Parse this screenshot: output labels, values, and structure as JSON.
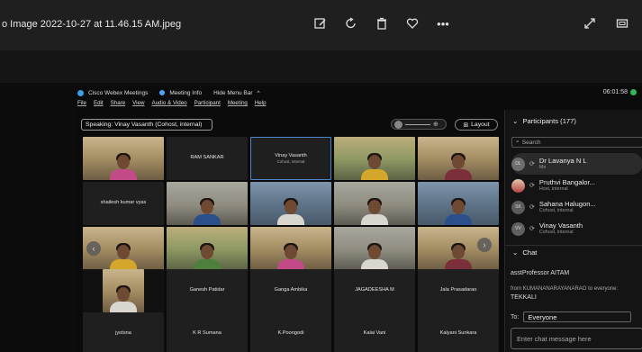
{
  "viewer": {
    "title": "o Image 2022-10-27 at 11.46.15 AM.jpeg",
    "tools": [
      "edit-icon",
      "rotate-icon",
      "trash-icon",
      "heart-icon",
      "more-icon"
    ],
    "right_tools": [
      "expand-icon",
      "fit-screen-icon"
    ],
    "more_label": "•••"
  },
  "webex": {
    "app_name": "Cisco Webex Meetings",
    "meeting_info": "Meeting Info",
    "hide_menu": "Hide Menu Bar",
    "time": "06:01:58",
    "menu": [
      "File",
      "Edit",
      "Share",
      "View",
      "Audio & Video",
      "Participant",
      "Meeting",
      "Help"
    ],
    "speaking": "Speaking: Vinay Vasanth (Cohost, internal)",
    "layout_label": "Layout",
    "tiles": [
      {
        "name": "",
        "video": true
      },
      {
        "name": "RAM SANKAR",
        "video": false
      },
      {
        "name": "Vinay Vasanth",
        "sub": "Cohost, internal",
        "video": false,
        "active": true
      },
      {
        "name": "",
        "video": true
      },
      {
        "name": "",
        "video": true
      },
      {
        "name": "shailesh kumar vyas",
        "video": false
      },
      {
        "name": "",
        "video": true
      },
      {
        "name": "",
        "video": true
      },
      {
        "name": "",
        "video": true
      },
      {
        "name": "",
        "video": true
      },
      {
        "name": "",
        "video": true
      },
      {
        "name": "",
        "video": true
      },
      {
        "name": "",
        "video": true
      },
      {
        "name": "",
        "video": true
      },
      {
        "name": "",
        "video": true
      },
      {
        "name": "",
        "video": true
      },
      {
        "name": "Ganesh Patidar",
        "video": false
      },
      {
        "name": "Ganga Ambika",
        "video": false
      },
      {
        "name": "JAGADEESHA M",
        "video": false
      },
      {
        "name": "Jala Prasadarao",
        "video": false
      },
      {
        "name": "jyotsna",
        "video": false
      },
      {
        "name": "K R Sumana",
        "video": false
      },
      {
        "name": "K.Poongodi",
        "video": false
      },
      {
        "name": "Kalai Vani",
        "video": false
      },
      {
        "name": "Kalyani Sunkara",
        "video": false
      }
    ]
  },
  "participants": {
    "header": "Participants (177)",
    "search_placeholder": "Search",
    "list": [
      {
        "initials": "DL",
        "name": "Dr Lavanya N L",
        "role": "Me"
      },
      {
        "initials": "",
        "name": "Pruthvi Bangalor...",
        "role": "Host, internal"
      },
      {
        "initials": "SK",
        "name": "Sahana Halugon...",
        "role": "Cohost, internal"
      },
      {
        "initials": "VV",
        "name": "Vinay Vasanth",
        "role": "Cohost, internal"
      }
    ]
  },
  "chat": {
    "header": "Chat",
    "line1": "asstProfessor AITAM",
    "from": "from KUMANANARAYANARAO to everyone:",
    "line2": "TEKKALI",
    "to_label": "To:",
    "to_value": "Everyone",
    "input_placeholder": "Enter chat message here"
  }
}
